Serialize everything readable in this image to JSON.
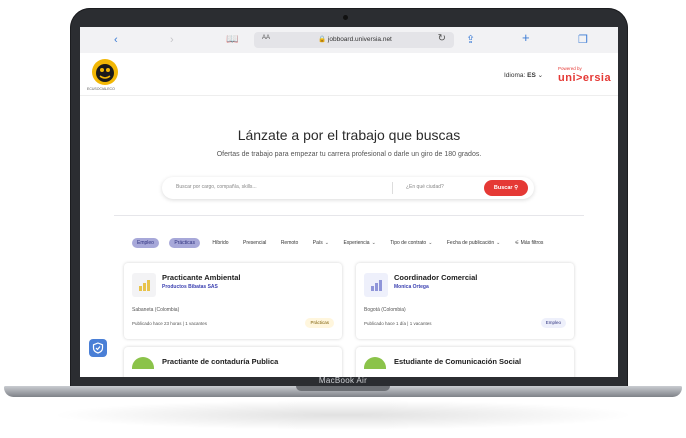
{
  "browser": {
    "text_size": "AA",
    "address": "jobboard.universia.net"
  },
  "header": {
    "logo_text": "ECUSOCIALECO",
    "language_label": "Idioma:",
    "language_value": "ES",
    "powered_by": "Powered by",
    "brand": "uni>ersia"
  },
  "hero": {
    "title": "Lánzate a por el trabajo que buscas",
    "subtitle": "Ofertas de trabajo para empezar tu carrera profesional o darle un giro de 180 grados.",
    "search_placeholder": "Buscar por cargo, compañía, skills...",
    "city_placeholder": "¿En qué ciudad?",
    "search_button": "Buscar"
  },
  "filters": [
    {
      "label": "Empleo",
      "selected": true,
      "dropdown": false
    },
    {
      "label": "Prácticas",
      "selected": true,
      "dropdown": false
    },
    {
      "label": "Híbrido",
      "selected": false,
      "dropdown": false
    },
    {
      "label": "Presencial",
      "selected": false,
      "dropdown": false
    },
    {
      "label": "Remoto",
      "selected": false,
      "dropdown": false
    },
    {
      "label": "País",
      "selected": false,
      "dropdown": true
    },
    {
      "label": "Experiencia",
      "selected": false,
      "dropdown": true
    },
    {
      "label": "Tipo de contrato",
      "selected": false,
      "dropdown": true
    },
    {
      "label": "Fecha de publicación",
      "selected": false,
      "dropdown": true
    },
    {
      "label": "Más filtros",
      "selected": false,
      "dropdown": false
    }
  ],
  "jobs": [
    {
      "title": "Practicante Ambiental",
      "company": "Productos Bibatas SAS",
      "location": "Sabaneta (Colombia)",
      "published": "Publicado hace 23 horas | 1 vacantes",
      "badge": "Prácticas"
    },
    {
      "title": "Coordinador Comercial",
      "company": "Monica Ortega",
      "location": "Bogotá (Colombia)",
      "published": "Publicado hace 1 día | 1 vacantes",
      "badge": "Empleo"
    },
    {
      "title": "Practiante de contaduría Publica",
      "company": "",
      "location": "",
      "published": "",
      "badge": ""
    },
    {
      "title": "Estudiante de Comunicación Social",
      "company": "",
      "location": "",
      "published": "",
      "badge": ""
    }
  ],
  "device": {
    "label": "MacBook Air"
  },
  "colors": {
    "accent_red": "#e53935",
    "chip_selected": "#a7a8d9",
    "company_link": "#3a3fb0",
    "browser_icon": "#3a7bd5"
  }
}
